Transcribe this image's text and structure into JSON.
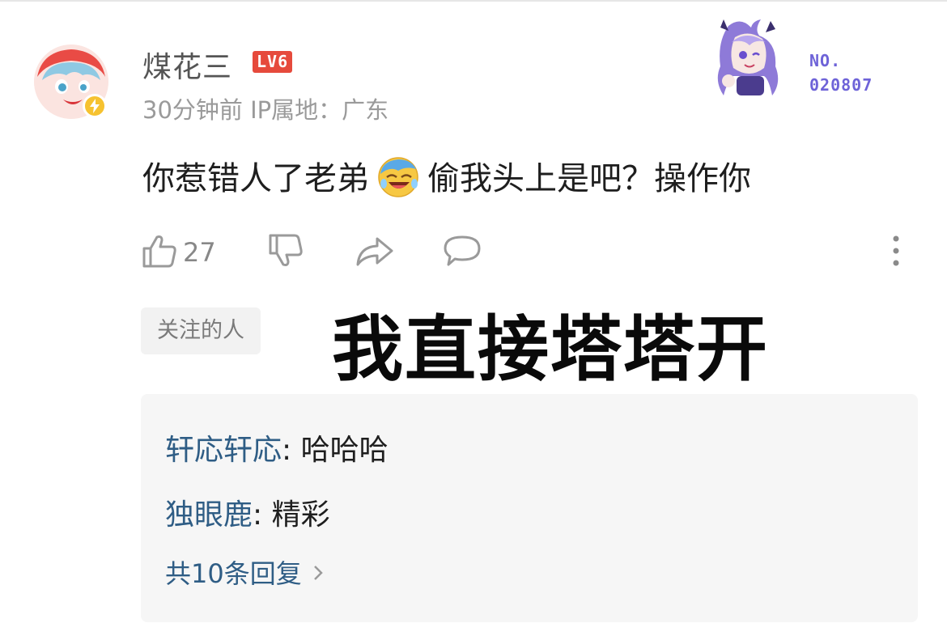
{
  "comment": {
    "username": "煤花三",
    "level_badge": "LV6",
    "time": "30分钟前",
    "ip_location": "IP属地：广东",
    "text_before_emoji": "你惹错人了老弟",
    "emoji": "laughing-crying-emoji",
    "text_after_emoji": "偷我头上是吧？操作你"
  },
  "decoration": {
    "serial_label": "NO.",
    "serial_number": "020807"
  },
  "actions": {
    "like_count": "27",
    "icons": [
      "thumbs-up-icon",
      "thumbs-down-icon",
      "share-icon",
      "comment-icon",
      "more-vertical-icon"
    ]
  },
  "follow_tag": "关注的人",
  "overlay_caption": "我直接塔塔开",
  "replies": [
    {
      "author": "轩応轩応",
      "text": "哈哈哈"
    },
    {
      "author": "独眼鹿",
      "text": "精彩"
    }
  ],
  "replies_more_label": "共10条回复",
  "colors": {
    "level_badge": "#e64a3c",
    "reply_author": "#2f5d85",
    "serial": "#6e63d8",
    "verified_badge": "#f6c230"
  }
}
